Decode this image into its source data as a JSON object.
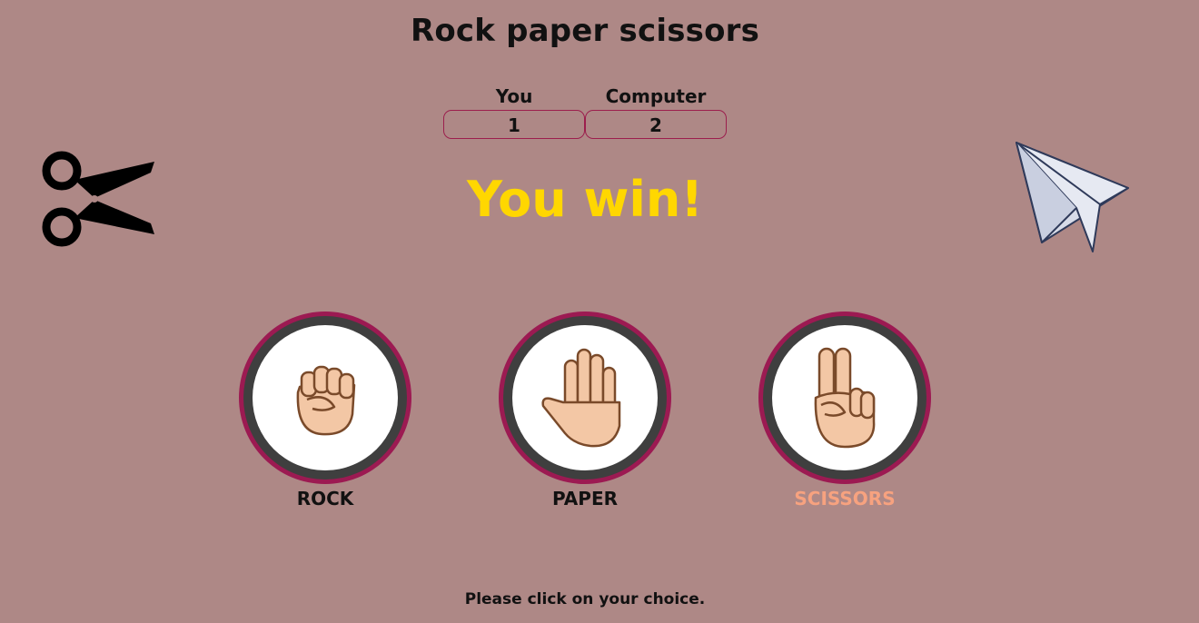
{
  "title": "Rock paper scissors",
  "scoreboard": {
    "you_label": "You",
    "you_score": "1",
    "computer_label": "Computer",
    "computer_score": "2"
  },
  "result": "You win!",
  "choices": [
    {
      "label": "ROCK",
      "icon": "fist-icon",
      "selected": false
    },
    {
      "label": "PAPER",
      "icon": "open-hand-icon",
      "selected": false
    },
    {
      "label": "SCISSORS",
      "icon": "victory-hand-icon",
      "selected": true
    }
  ],
  "decorations": {
    "left_icon": "scissors-icon",
    "right_icon": "paper-plane-icon"
  },
  "footer": "Please click on your choice.",
  "colors": {
    "background": "#ae8886",
    "accent": "#9c1a52",
    "result": "#ffd700",
    "selected_label": "#f7a27f"
  }
}
